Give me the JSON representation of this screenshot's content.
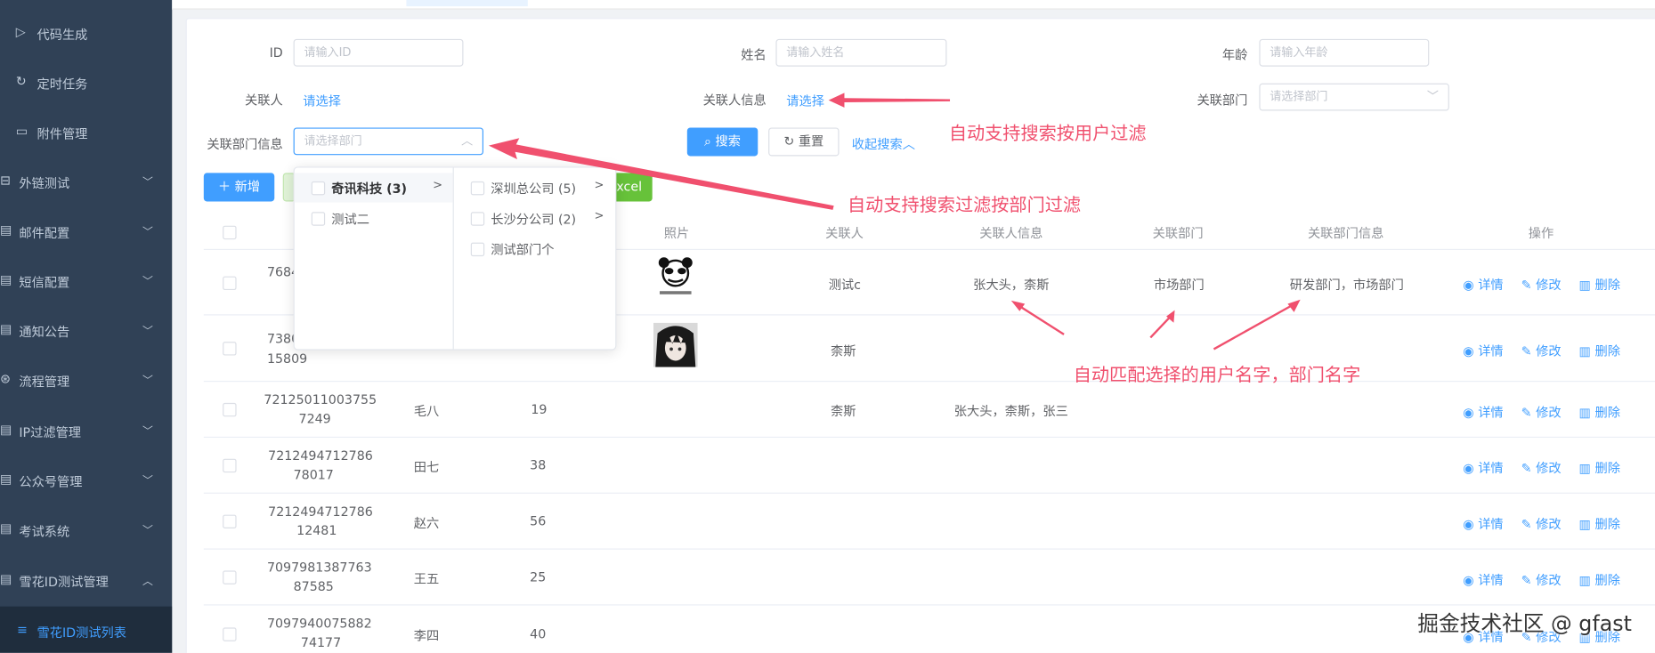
{
  "sidebar": {
    "items": [
      {
        "label": "代码生成",
        "icon": "code-icon"
      },
      {
        "label": "定时任务",
        "icon": "refresh-icon"
      },
      {
        "label": "附件管理",
        "icon": "folder-icon"
      },
      {
        "label": "外链测试",
        "icon": "link-icon"
      },
      {
        "label": "邮件配置",
        "icon": "mail-icon"
      },
      {
        "label": "短信配置",
        "icon": "sms-icon"
      },
      {
        "label": "通知公告",
        "icon": "notice-icon"
      },
      {
        "label": "流程管理",
        "icon": "flow-icon"
      },
      {
        "label": "IP过滤管理",
        "icon": "filter-icon"
      },
      {
        "label": "公众号管理",
        "icon": "wechat-icon"
      },
      {
        "label": "考试系统",
        "icon": "exam-icon"
      },
      {
        "label": "雪花ID测试管理",
        "icon": "snowflake-icon"
      },
      {
        "label": "雪花ID测试列表",
        "icon": "list-icon"
      }
    ]
  },
  "search": {
    "id_label": "ID",
    "id_placeholder": "请输入ID",
    "name_label": "姓名",
    "name_placeholder": "请输入姓名",
    "age_label": "年龄",
    "age_placeholder": "请输入年龄",
    "contact_label": "关联人",
    "contact_link": "请选择",
    "contact_info_label": "关联人信息",
    "contact_info_link": "请选择",
    "dept_label": "关联部门",
    "dept_placeholder": "请选择部门",
    "dept_info_label": "关联部门信息",
    "dept_info_placeholder": "请选择部门",
    "search_button": "搜索",
    "reset_button": "重置",
    "collapse_link": "收起搜索"
  },
  "toolbar": {
    "add_button": "新增",
    "excel_button": "xcel"
  },
  "cascader": {
    "col1": [
      {
        "label": "奇讯科技 (3)",
        "has_children": true,
        "active": true
      },
      {
        "label": "测试二",
        "has_children": false,
        "active": false
      }
    ],
    "col2": [
      {
        "label": "深圳总公司 (5)",
        "has_children": true
      },
      {
        "label": "长沙分公司 (2)",
        "has_children": true
      },
      {
        "label": "测试部门个",
        "has_children": false
      }
    ]
  },
  "table": {
    "headers": {
      "photo": "照片",
      "contact": "关联人",
      "contact_info": "关联人信息",
      "dept": "关联部门",
      "dept_info": "关联部门信息",
      "ops": "操作"
    },
    "ops_labels": {
      "detail": "详情",
      "edit": "修改",
      "delete": "删除"
    },
    "rows": [
      {
        "id_line1": "7684",
        "id_line2": "",
        "name": "",
        "age": "",
        "photo": "panda-meme",
        "contact": "测试c",
        "contact_info": "张大头，柰斯",
        "dept": "市场部门",
        "dept_info": "研发部门，市场部门"
      },
      {
        "id_line1": "7380",
        "id_line2": "15809",
        "name": "",
        "age": "",
        "photo": "anime-avatar",
        "contact": "柰斯",
        "contact_info": "",
        "dept": "",
        "dept_info": ""
      },
      {
        "id_line1": "72125011003755",
        "id_line2": "7249",
        "name": "毛八",
        "age": "19",
        "photo": "",
        "contact": "柰斯",
        "contact_info": "张大头，柰斯，张三",
        "dept": "",
        "dept_info": ""
      },
      {
        "id_line1": "7212494712786",
        "id_line2": "78017",
        "name": "田七",
        "age": "38",
        "photo": "",
        "contact": "",
        "contact_info": "",
        "dept": "",
        "dept_info": ""
      },
      {
        "id_line1": "7212494712786",
        "id_line2": "12481",
        "name": "赵六",
        "age": "56",
        "photo": "",
        "contact": "",
        "contact_info": "",
        "dept": "",
        "dept_info": ""
      },
      {
        "id_line1": "7097981387763",
        "id_line2": "87585",
        "name": "王五",
        "age": "25",
        "photo": "",
        "contact": "",
        "contact_info": "",
        "dept": "",
        "dept_info": ""
      },
      {
        "id_line1": "7097940075882",
        "id_line2": "74177",
        "name": "李四",
        "age": "40",
        "photo": "",
        "contact": "",
        "contact_info": "",
        "dept": "",
        "dept_info": ""
      }
    ]
  },
  "annotations": {
    "user_filter": "自动支持搜索按用户过滤",
    "dept_filter": "自动支持搜索过滤按部门过滤",
    "auto_match": "自动匹配选择的用户名字，部门名字",
    "color": "#f0506e"
  },
  "watermark": "掘金技术社区 @ gfast",
  "colors": {
    "sidebar_bg": "#304156",
    "primary": "#409eff",
    "success": "#67c23a",
    "annotation": "#f0506e"
  }
}
